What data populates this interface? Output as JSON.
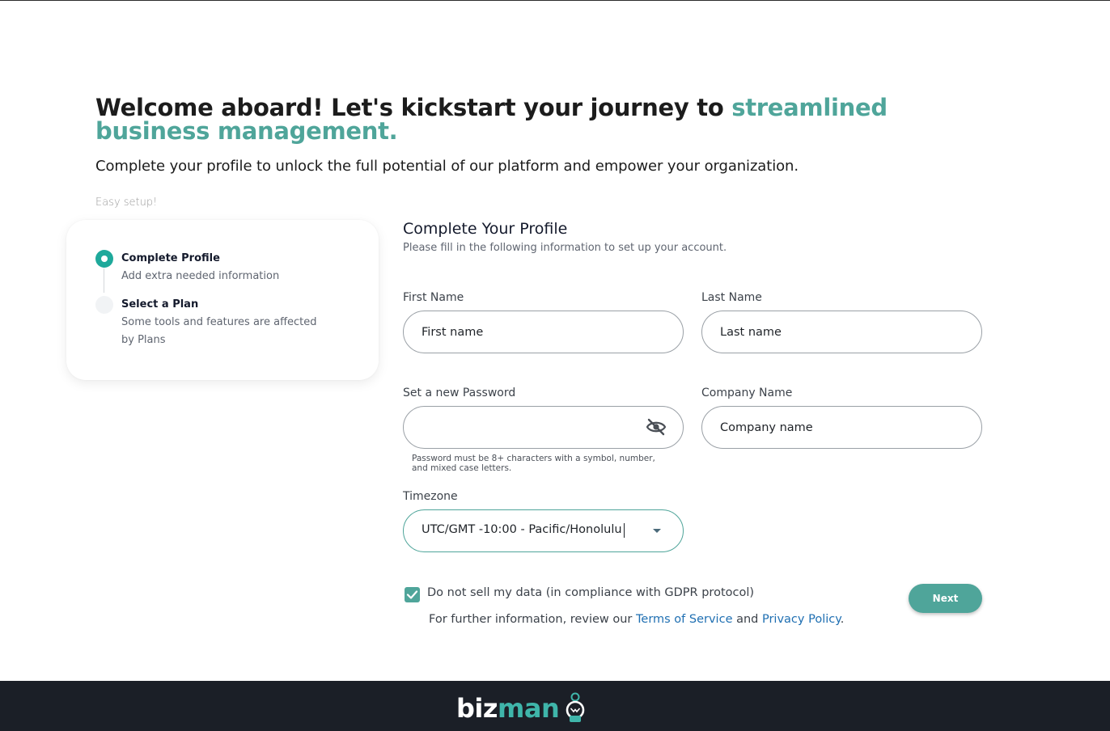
{
  "hero": {
    "title_prefix": "Welcome aboard! Let's kickstart your journey to ",
    "title_accent": "streamlined business management.",
    "subtitle": "Complete your profile to unlock the full potential of our platform and empower your organization."
  },
  "setup": {
    "label": "Easy setup!",
    "steps": [
      {
        "title": "Complete Profile",
        "description": "Add extra needed information",
        "status": "active"
      },
      {
        "title": "Select a Plan",
        "description": "Some tools and features are affected by Plans",
        "status": "inactive"
      }
    ]
  },
  "form": {
    "title": "Complete Your Profile",
    "subtitle": "Please fill in the following information to set up your account.",
    "first_name": {
      "label": "First Name",
      "placeholder": "First name",
      "value": ""
    },
    "last_name": {
      "label": "Last Name",
      "placeholder": "Last name",
      "value": ""
    },
    "password": {
      "label": "Set a new Password",
      "value": "",
      "hint": "Password must be 8+ characters with a symbol, number, and mixed case letters."
    },
    "company": {
      "label": "Company Name",
      "placeholder": "Company name",
      "value": ""
    },
    "timezone": {
      "label": "Timezone",
      "value": "UTC/GMT -10:00 - Pacific/Honolulu"
    },
    "gdpr": {
      "checked": true,
      "label": "Do not sell my data (in compliance with GDPR protocol)",
      "info_prefix": "For further information, review our ",
      "terms_link": "Terms of Service",
      "and": " and ",
      "privacy_link": "Privacy Policy",
      "suffix": "."
    },
    "next_label": "Next"
  },
  "footer": {
    "logo_biz": "biz",
    "logo_man": "man"
  },
  "colors": {
    "accent": "#4fa59a",
    "step_active": "#1ea99b",
    "link": "#1f6fb2",
    "footer_bg": "#1b1f27"
  },
  "icons": [
    "eye-off-icon",
    "checkmark-icon",
    "chevron-down-icon",
    "logo-robot-icon"
  ]
}
